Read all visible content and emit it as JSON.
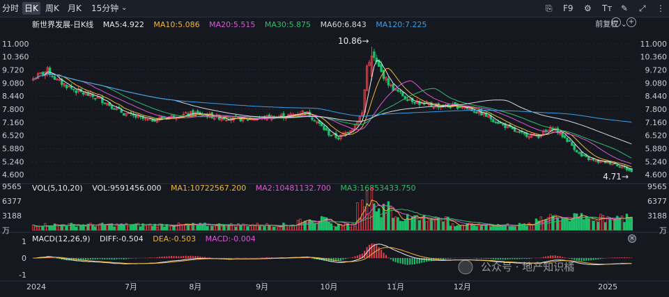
{
  "toolbar": {
    "tabs": [
      "分时",
      "日K",
      "周K",
      "月K",
      "15分钟"
    ],
    "active_tab": "日K",
    "f9": "F9"
  },
  "main_legend": {
    "name": "新世界发展-日K线",
    "ma5": "MA5:4.922",
    "ma10": "MA10:5.086",
    "ma20": "MA20:5.515",
    "ma30": "MA30:5.875",
    "ma60": "MA60:6.843",
    "ma120": "MA120:7.225",
    "adjust": "前复权"
  },
  "vol_legend": {
    "name": "VOL(5,10,20)",
    "vol": "VOL:9591456.000",
    "ma1": "MA1:10722567.200",
    "ma2": "MA2:10481132.700",
    "ma3": "MA3:16853433.750"
  },
  "macd_legend": {
    "name": "MACD(12,26,9)",
    "diff": "DIFF:-0.504",
    "dea": "DEA:-0.503",
    "macd": "MACD:-0.004"
  },
  "watermark": "公众号 · 地产知识橘",
  "colors": {
    "up": "#e8404b",
    "down": "#1dbf6b",
    "ma5": "#e9e9ee",
    "ma10": "#f0b73a",
    "ma20": "#d95ad3",
    "ma30": "#2fbf6a",
    "ma60": "#d8d8e0",
    "ma120": "#3aa0e8",
    "diff": "#e9e9ee",
    "dea": "#f0b73a"
  },
  "chart_data": {
    "type": "candlestick",
    "price_ticks": [
      "11.000",
      "10.360",
      "9.720",
      "9.080",
      "8.440",
      "7.800",
      "7.160",
      "6.520",
      "5.880",
      "5.240",
      "4.600"
    ],
    "price_range": [
      4.3,
      11.2
    ],
    "x_labels": [
      "2024",
      "7月",
      "8月",
      "9月",
      "10月",
      "11月",
      "12月",
      "2025"
    ],
    "annotations": {
      "high": "10.86→",
      "low": "4.71→"
    },
    "close_anchors": [
      [
        0,
        9.3
      ],
      [
        6,
        9.7
      ],
      [
        10,
        9.2
      ],
      [
        18,
        8.7
      ],
      [
        28,
        8.3
      ],
      [
        38,
        7.6
      ],
      [
        48,
        7.25
      ],
      [
        58,
        7.45
      ],
      [
        68,
        7.6
      ],
      [
        78,
        7.4
      ],
      [
        88,
        7.3
      ],
      [
        98,
        7.4
      ],
      [
        108,
        7.5
      ],
      [
        114,
        7.7
      ],
      [
        118,
        7.3
      ],
      [
        124,
        6.6
      ],
      [
        128,
        6.4
      ],
      [
        134,
        6.9
      ],
      [
        138,
        7.6
      ],
      [
        140,
        9.9
      ],
      [
        142,
        10.5
      ],
      [
        146,
        9.6
      ],
      [
        150,
        8.9
      ],
      [
        156,
        8.4
      ],
      [
        164,
        8.0
      ],
      [
        172,
        7.95
      ],
      [
        180,
        7.95
      ],
      [
        188,
        7.6
      ],
      [
        196,
        7.1
      ],
      [
        204,
        6.6
      ],
      [
        212,
        6.5
      ],
      [
        218,
        6.9
      ],
      [
        224,
        6.3
      ],
      [
        230,
        5.5
      ],
      [
        236,
        5.25
      ],
      [
        242,
        5.2
      ],
      [
        247,
        5.0
      ],
      [
        251,
        4.75
      ]
    ],
    "vol_ticks": [
      "9565",
      "6377",
      "3188",
      "万"
    ],
    "vol_range": [
      0,
      9565
    ],
    "macd_ticks": [
      "1",
      "0",
      "-1"
    ],
    "macd_range": [
      -1.2,
      1.2
    ],
    "n_bars": 252
  }
}
